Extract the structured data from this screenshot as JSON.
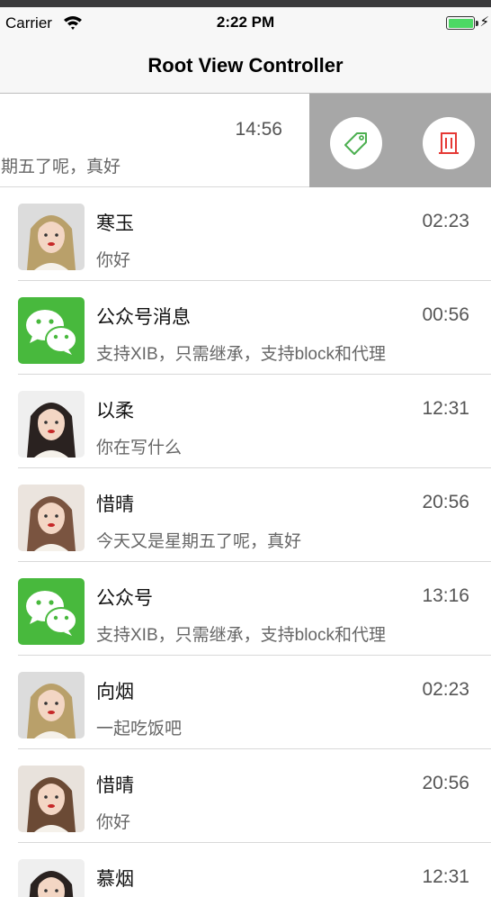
{
  "status_bar": {
    "carrier": "Carrier",
    "time": "2:22 PM"
  },
  "nav": {
    "title": "Root View Controller"
  },
  "swiped_row": {
    "time": "14:56",
    "text": "星期五了呢，真好"
  },
  "actions": {
    "tag_icon": "tag-icon",
    "delete_icon": "trash-icon",
    "tag_color": "#4caf50",
    "delete_color": "#e53935"
  },
  "rows": [
    {
      "name": "寒玉",
      "time": "02:23",
      "text": "你好",
      "avatar": "portrait"
    },
    {
      "name": "公众号消息",
      "time": "00:56",
      "text": "支持XIB，只需继承，支持block和代理",
      "avatar": "wechat"
    },
    {
      "name": "以柔",
      "time": "12:31",
      "text": "你在写什么",
      "avatar": "portrait"
    },
    {
      "name": "惜晴",
      "time": "20:56",
      "text": "今天又是星期五了呢，真好",
      "avatar": "portrait"
    },
    {
      "name": "公众号",
      "time": "13:16",
      "text": "支持XIB，只需继承，支持block和代理",
      "avatar": "wechat"
    },
    {
      "name": "向烟",
      "time": "02:23",
      "text": "一起吃饭吧",
      "avatar": "portrait"
    },
    {
      "name": "惜晴",
      "time": "20:56",
      "text": "你好",
      "avatar": "portrait"
    },
    {
      "name": "慕烟",
      "time": "12:31",
      "text": "",
      "avatar": "portrait"
    }
  ]
}
